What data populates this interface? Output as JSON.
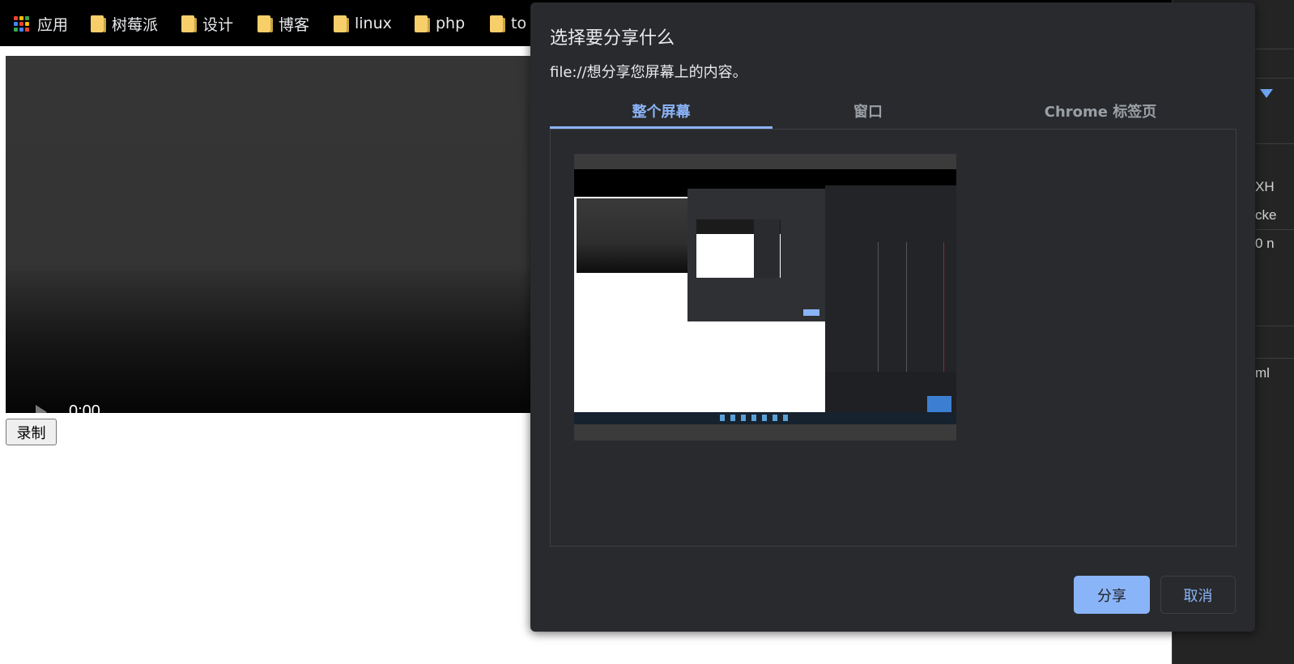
{
  "bookmarks_bar": {
    "apps_label": "应用",
    "items": [
      {
        "label": "树莓派"
      },
      {
        "label": "设计"
      },
      {
        "label": "博客"
      },
      {
        "label": "linux"
      },
      {
        "label": "php"
      },
      {
        "label": "to"
      }
    ]
  },
  "video": {
    "time": "0:00"
  },
  "page": {
    "record_label": "录制"
  },
  "devtools": {
    "visible_fragments": [
      "XH",
      "cke",
      "0 n",
      "ml"
    ]
  },
  "dialog": {
    "title": "选择要分享什么",
    "subtitle": "file://想分享您屏幕上的内容。",
    "tabs": [
      {
        "label": "整个屏幕",
        "active": true
      },
      {
        "label": "窗口",
        "active": false
      },
      {
        "label": "Chrome 标签页",
        "active": false
      }
    ],
    "share_label": "分享",
    "cancel_label": "取消"
  },
  "colors": {
    "accent": "#8ab4f8",
    "dialog_bg": "#292a2d",
    "folder": "#f6cf6a"
  }
}
